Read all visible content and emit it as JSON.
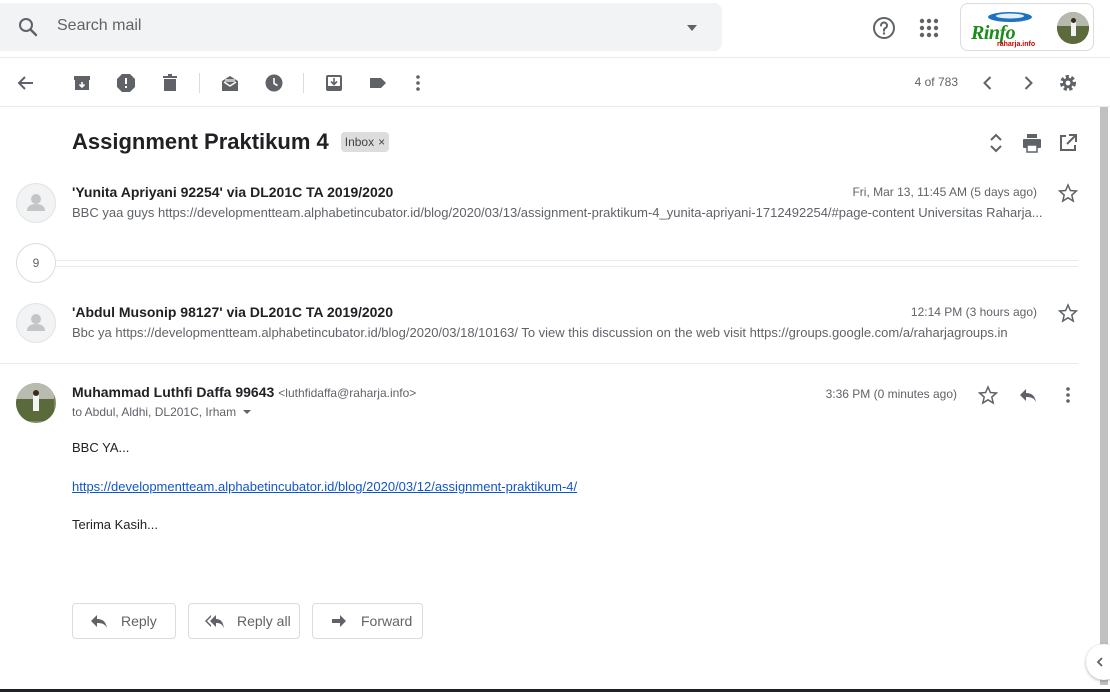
{
  "search": {
    "placeholder": "Search mail"
  },
  "brand": {
    "logo_text": "Rinfo",
    "logo_sub": "raharja.info"
  },
  "toolbar": {
    "pager": "4 of 783"
  },
  "thread": {
    "subject": "Assignment Praktikum 4",
    "label": "Inbox",
    "label_remove": "×",
    "collapsed_count": "9",
    "messages": [
      {
        "sender": "'Yunita Apriyani 92254' via DL201C TA 2019/2020",
        "date": "Fri, Mar 13, 11:45 AM (5 days ago)",
        "snippet": "BBC yaa guys https://developmentteam.alphabetincubator.id/blog/2020/03/13/assignment-praktikum-4_yunita-apriyani-1712492254/#page-content Universitas Raharja..."
      },
      {
        "sender": "'Abdul Musonip 98127' via DL201C TA 2019/2020",
        "date": "12:14 PM (3 hours ago)",
        "snippet": "Bbc ya https://developmentteam.alphabetincubator.id/blog/2020/03/18/10163/ To view this discussion on the web visit https://groups.google.com/a/raharjagroups.in"
      }
    ],
    "open_message": {
      "sender": "Muhammad Luthfi Daffa 99643",
      "email": "<luthfidaffa@raharja.info>",
      "date": "3:36 PM (0 minutes ago)",
      "to": "to Abdul, Aldhi, DL201C, Irham",
      "body_line1": "BBC YA...",
      "body_link": "https://developmentteam.alphabetincubator.id/blog/2020/03/12/assignment-praktikum-4/",
      "body_line3": "Terima Kasih..."
    }
  },
  "actions": {
    "reply": "Reply",
    "reply_all": "Reply all",
    "forward": "Forward"
  },
  "colors": {
    "link": "#1155cc",
    "icon": "#5f6368",
    "search_bg": "#f1f3f4",
    "chip_bg": "#dddddd"
  }
}
